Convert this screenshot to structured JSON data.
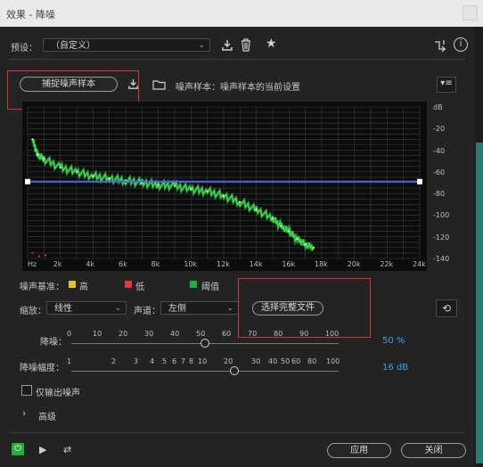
{
  "window": {
    "title": "效果 - 降噪"
  },
  "preset": {
    "label": "预设：",
    "value": "（自定义）"
  },
  "capture_button": "捕捉噪声样本",
  "noise_sample_text": "噪声样本：噪声样本的当前设置",
  "chart_data": {
    "type": "line",
    "x_ticks": [
      "Hz",
      "2k",
      "4k",
      "6k",
      "8k",
      "10k",
      "12k",
      "14k",
      "16k",
      "18k",
      "20k",
      "22k",
      "24k"
    ],
    "y_ticks": [
      "dB",
      "-20",
      "-40",
      "-60",
      "-80",
      "-100",
      "-120",
      "-140"
    ],
    "xlim": [
      0,
      24000
    ],
    "ylim": [
      -140,
      0
    ],
    "grid": true,
    "threshold_db": -69,
    "series": [
      {
        "x": [
          300,
          600,
          1000,
          2000,
          3000,
          4000,
          5000,
          6000,
          7000,
          8000,
          9000,
          10000,
          11000,
          12000,
          13000,
          14000,
          15000,
          15500,
          16000,
          16500,
          17000,
          17500
        ],
        "y": [
          -30,
          -44,
          -48,
          -56,
          -60,
          -64,
          -66,
          -68,
          -70,
          -72,
          -73,
          -76,
          -78,
          -82,
          -88,
          -95,
          -103,
          -110,
          -115,
          -122,
          -127,
          -130
        ]
      }
    ],
    "colors": {
      "spectrum": "#3ee05a",
      "threshold": "#4d64e8",
      "low_marks": "#d63333"
    }
  },
  "legend": {
    "label": "噪声基准：",
    "items": [
      {
        "label": "高",
        "color": "#e8c21d"
      },
      {
        "label": "低",
        "color": "#e23a3a"
      },
      {
        "label": "阈值",
        "color": "#1fae36"
      }
    ]
  },
  "scale": {
    "label": "缩放：",
    "value": "线性"
  },
  "channel": {
    "label": "声道：",
    "value": "左侧"
  },
  "select_file_button": "选择完整文件",
  "noise_reduction": {
    "label": "降噪：",
    "ticks": [
      "0",
      "10",
      "20",
      "30",
      "40",
      "50",
      "60",
      "70",
      "80",
      "90",
      "100"
    ],
    "value": "50",
    "unit": "%"
  },
  "reduce_by": {
    "label": "降噪幅度：",
    "ticks": [
      "1",
      "2",
      "3",
      "4",
      "5",
      "6",
      "7",
      "8",
      "10",
      "20",
      "30",
      "40",
      "50",
      "60",
      "80",
      "100"
    ],
    "value": "16",
    "unit": "dB"
  },
  "output_noise_only": "仅输出噪声",
  "advanced": "高级",
  "footer": {
    "apply": "应用",
    "close": "关闭"
  }
}
